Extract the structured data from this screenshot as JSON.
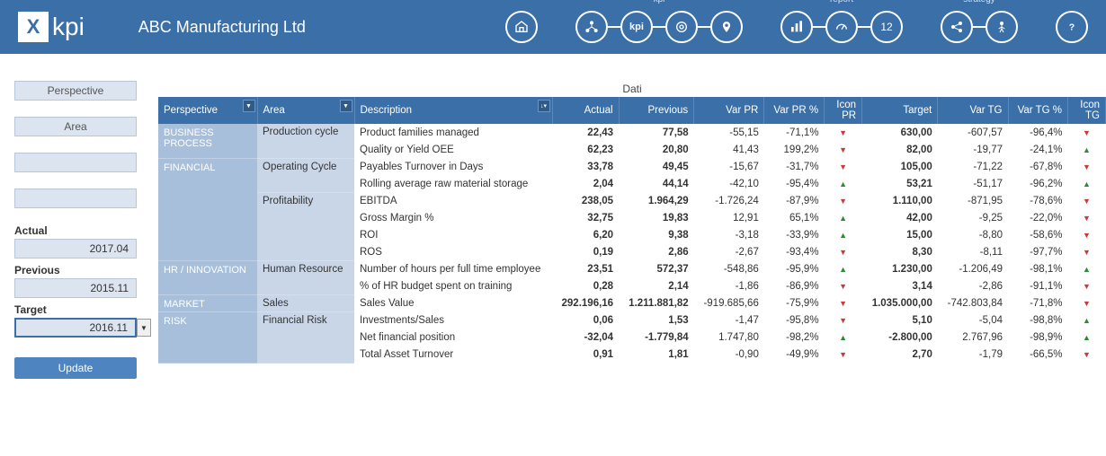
{
  "header": {
    "logo_text": "kpi",
    "company": "ABC Manufacturing Ltd",
    "nav_labels": {
      "kpi": "kpi",
      "report": "report",
      "strategy": "strategy"
    }
  },
  "sidebar": {
    "filters": [
      {
        "label": "Perspective"
      },
      {
        "label": "Area"
      },
      {
        "label": ""
      },
      {
        "label": ""
      }
    ],
    "periods": [
      {
        "label": "Actual",
        "value": "2017.04"
      },
      {
        "label": "Previous",
        "value": "2015.11"
      },
      {
        "label": "Target",
        "value": "2016.11"
      }
    ],
    "update": "Update"
  },
  "table": {
    "title": "Dati",
    "headers": {
      "perspective": "Perspective",
      "area": "Area",
      "description": "Description",
      "actual": "Actual",
      "previous": "Previous",
      "var_pr": "Var PR",
      "var_pr_pct": "Var PR %",
      "icon_pr": "Icon PR",
      "target": "Target",
      "var_tg": "Var TG",
      "var_tg_pct": "Var TG %",
      "icon_tg": "Icon TG"
    },
    "rows": [
      {
        "perspective": "BUSINESS PROCESS",
        "p_span": 2,
        "area": "Production cycle",
        "a_span": 2,
        "description": "Product families managed",
        "actual": "22,43",
        "previous": "77,58",
        "var_pr": "-55,15",
        "var_pr_pct": "-71,1%",
        "icon_pr": "down",
        "target": "630,00",
        "var_tg": "-607,57",
        "var_tg_pct": "-96,4%",
        "icon_tg": "down"
      },
      {
        "description": "Quality or Yield OEE",
        "actual": "62,23",
        "previous": "20,80",
        "var_pr": "41,43",
        "var_pr_pct": "199,2%",
        "icon_pr": "down",
        "target": "82,00",
        "var_tg": "-19,77",
        "var_tg_pct": "-24,1%",
        "icon_tg": "up"
      },
      {
        "perspective": "FINANCIAL",
        "p_span": 6,
        "area": "Operating Cycle",
        "a_span": 2,
        "description": "Payables Turnover in Days",
        "actual": "33,78",
        "previous": "49,45",
        "var_pr": "-15,67",
        "var_pr_pct": "-31,7%",
        "icon_pr": "down",
        "target": "105,00",
        "var_tg": "-71,22",
        "var_tg_pct": "-67,8%",
        "icon_tg": "down"
      },
      {
        "description": "Rolling average raw material storage",
        "actual": "2,04",
        "previous": "44,14",
        "var_pr": "-42,10",
        "var_pr_pct": "-95,4%",
        "icon_pr": "up",
        "target": "53,21",
        "var_tg": "-51,17",
        "var_tg_pct": "-96,2%",
        "icon_tg": "up"
      },
      {
        "area": "Profitability",
        "a_span": 4,
        "description": "EBITDA",
        "actual": "238,05",
        "previous": "1.964,29",
        "var_pr": "-1.726,24",
        "var_pr_pct": "-87,9%",
        "icon_pr": "down",
        "target": "1.110,00",
        "var_tg": "-871,95",
        "var_tg_pct": "-78,6%",
        "icon_tg": "down"
      },
      {
        "description": "Gross Margin %",
        "actual": "32,75",
        "previous": "19,83",
        "var_pr": "12,91",
        "var_pr_pct": "65,1%",
        "icon_pr": "up",
        "target": "42,00",
        "var_tg": "-9,25",
        "var_tg_pct": "-22,0%",
        "icon_tg": "down"
      },
      {
        "description": "ROI",
        "actual": "6,20",
        "previous": "9,38",
        "var_pr": "-3,18",
        "var_pr_pct": "-33,9%",
        "icon_pr": "up",
        "target": "15,00",
        "var_tg": "-8,80",
        "var_tg_pct": "-58,6%",
        "icon_tg": "down"
      },
      {
        "description": "ROS",
        "actual": "0,19",
        "previous": "2,86",
        "var_pr": "-2,67",
        "var_pr_pct": "-93,4%",
        "icon_pr": "down",
        "target": "8,30",
        "var_tg": "-8,11",
        "var_tg_pct": "-97,7%",
        "icon_tg": "down"
      },
      {
        "perspective": "HR / INNOVATION",
        "p_span": 2,
        "area": "Human Resource",
        "a_span": 2,
        "description": "Number of hours per full time employee",
        "actual": "23,51",
        "previous": "572,37",
        "var_pr": "-548,86",
        "var_pr_pct": "-95,9%",
        "icon_pr": "up",
        "target": "1.230,00",
        "var_tg": "-1.206,49",
        "var_tg_pct": "-98,1%",
        "icon_tg": "up"
      },
      {
        "description": "% of HR budget spent on training",
        "actual": "0,28",
        "previous": "2,14",
        "var_pr": "-1,86",
        "var_pr_pct": "-86,9%",
        "icon_pr": "down",
        "target": "3,14",
        "var_tg": "-2,86",
        "var_tg_pct": "-91,1%",
        "icon_tg": "down"
      },
      {
        "perspective": "MARKET",
        "p_span": 1,
        "area": "Sales",
        "a_span": 1,
        "description": "Sales Value",
        "actual": "292.196,16",
        "previous": "1.211.881,82",
        "var_pr": "-919.685,66",
        "var_pr_pct": "-75,9%",
        "icon_pr": "down",
        "target": "1.035.000,00",
        "var_tg": "-742.803,84",
        "var_tg_pct": "-71,8%",
        "icon_tg": "down"
      },
      {
        "perspective": "RISK",
        "p_span": 3,
        "area": "Financial Risk",
        "a_span": 3,
        "description": "Investments/Sales",
        "actual": "0,06",
        "previous": "1,53",
        "var_pr": "-1,47",
        "var_pr_pct": "-95,8%",
        "icon_pr": "down",
        "target": "5,10",
        "var_tg": "-5,04",
        "var_tg_pct": "-98,8%",
        "icon_tg": "up"
      },
      {
        "description": "Net financial position",
        "actual": "-32,04",
        "previous": "-1.779,84",
        "var_pr": "1.747,80",
        "var_pr_pct": "-98,2%",
        "icon_pr": "up",
        "target": "-2.800,00",
        "var_tg": "2.767,96",
        "var_tg_pct": "-98,9%",
        "icon_tg": "up"
      },
      {
        "description": "Total Asset Turnover",
        "actual": "0,91",
        "previous": "1,81",
        "var_pr": "-0,90",
        "var_pr_pct": "-49,9%",
        "icon_pr": "down",
        "target": "2,70",
        "var_tg": "-1,79",
        "var_tg_pct": "-66,5%",
        "icon_tg": "down"
      }
    ]
  }
}
